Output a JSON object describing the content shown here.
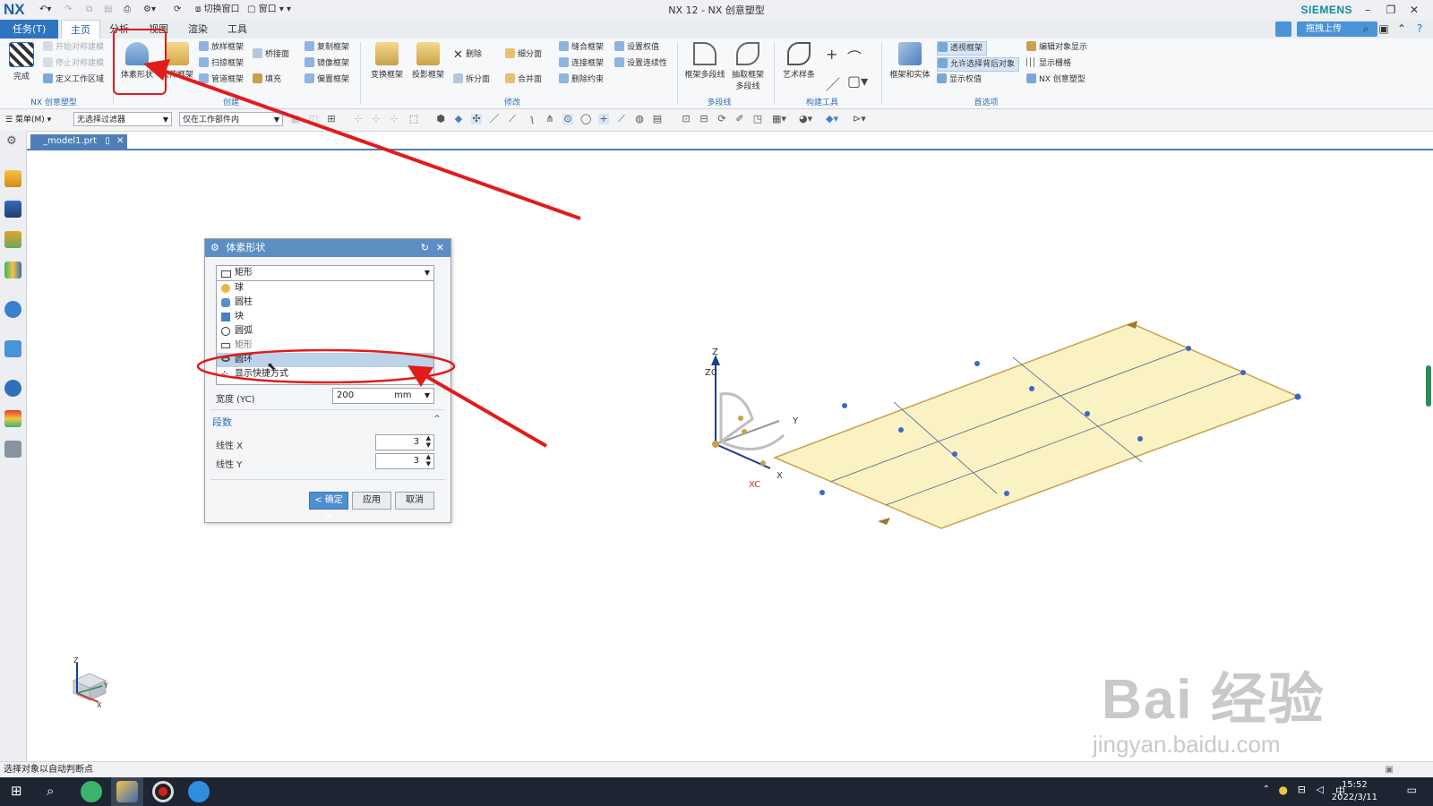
{
  "app": {
    "logo": "NX",
    "title": "NX 12 - NX 创意塑型",
    "brand": "SIEMENS",
    "quick_access": [
      "切换窗口",
      "窗口"
    ]
  },
  "menu_tabs": [
    "任务(T)",
    "主页",
    "分析",
    "视图",
    "渲染",
    "工具"
  ],
  "cloud_button": "拖拽上传",
  "ribbon": {
    "groups": [
      "NX 创意塑型",
      "创建",
      "修改",
      "多段线",
      "构建工具",
      "首选项"
    ],
    "finish": "完成",
    "disabled_items": [
      "开始对称建模",
      "停止对称建模"
    ],
    "define_region": "定义工作区域",
    "primitive_shape": "体素形状",
    "extrude_frame": "拉伸框架",
    "create_small": [
      "放样框架",
      "扫掠框架",
      "管道框架",
      "桥接面",
      "填充",
      "复制框架",
      "镜像框架",
      "偏置框架"
    ],
    "modify_big": [
      "变换框架",
      "投影框架"
    ],
    "modify_small": [
      "删除",
      "细分面",
      "拆分面",
      "合并面",
      "缝合框架",
      "连接框架",
      "删除约束",
      "设置权值",
      "设置连续性"
    ],
    "polyline_items": [
      "框架多段线",
      "抽取框架多段线"
    ],
    "build_tools": [
      "艺术样条"
    ],
    "prefs_big": "框架和实体",
    "prefs_small": [
      "透视框架",
      "允许选择背后对象",
      "显示权值",
      "编辑对象显示",
      "显示栅格",
      "NX 创意塑型"
    ]
  },
  "toolbar": {
    "menu": "菜单(M)",
    "filter": "无选择过滤器",
    "scope": "仅在工作部件内"
  },
  "doc_tab": "_model1.prt",
  "dialog": {
    "title": "体素形状",
    "selected_type": "矩形",
    "options": [
      "球",
      "圆柱",
      "块",
      "圆弧",
      "矩形",
      "圆环"
    ],
    "highlighted_option": "圆环",
    "shortcut_item": "显示快捷方式",
    "width_label": "宽度 (YC)",
    "width_value": "200",
    "width_unit": "mm",
    "segments_section": "段数",
    "linear_x_label": "线性 X",
    "linear_x_value": "3",
    "linear_y_label": "线性 Y",
    "linear_y_value": "3",
    "ok": "< 确定 >",
    "apply": "应用",
    "cancel": "取消"
  },
  "viewport": {
    "axis_z": "Z",
    "axis_zc": "ZC",
    "axis_y": "Y",
    "axis_x": "X",
    "axis_xc": "XC",
    "mini_triad": [
      "Z",
      "Y",
      "X"
    ]
  },
  "status_text": "选择对象以自动判断点",
  "taskbar": {
    "ime": "中",
    "time": "15:52",
    "date": "2022/3/11"
  },
  "watermark": {
    "main": "Bai 经验",
    "url": "jingyan.baidu.com"
  },
  "colors": {
    "file_tab": "#2f74c0",
    "ribbon_group_label": "#2f6fb8",
    "dialog_title": "#5b8fc4",
    "sheet_fill": "#fbf2c4",
    "annotation_red": "#e21b1b",
    "taskbar": "#1c2531"
  }
}
